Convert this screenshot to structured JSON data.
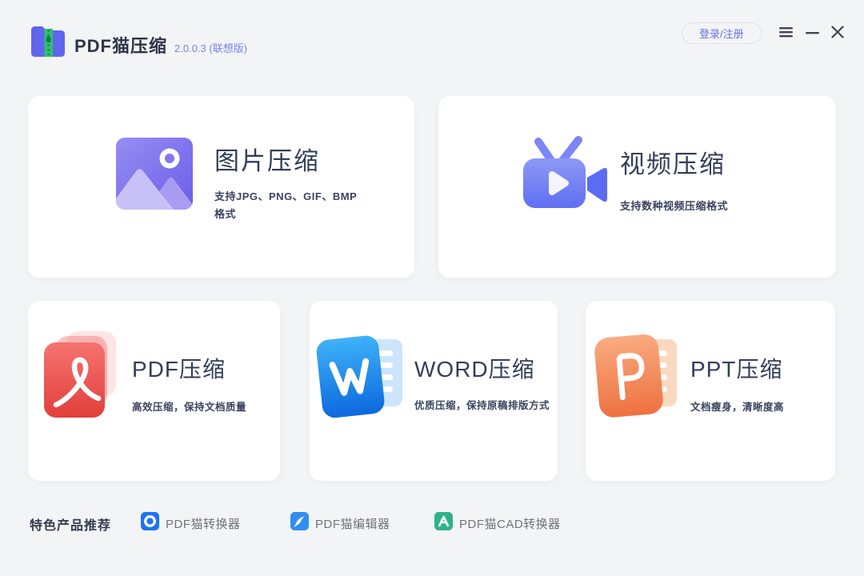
{
  "window": {
    "app_title": "PDF猫压缩",
    "version": "2.0.0.3 (联想版)",
    "login_label": "登录/注册",
    "controls": [
      "menu",
      "minimize",
      "close"
    ]
  },
  "cards": {
    "image": {
      "title": "图片压缩",
      "desc": "支持JPG、PNG、GIF、BMP格式",
      "icon": "image-icon"
    },
    "video": {
      "title": "视频压缩",
      "desc": "支持数种视频压缩格式",
      "icon": "video-camera-icon"
    },
    "pdf": {
      "title": "PDF压缩",
      "desc": "高效压缩，保持文档质量",
      "icon": "pdf-document-icon"
    },
    "word": {
      "title": "WORD压缩",
      "desc": "优质压缩，保持原稿排版方式",
      "icon": "word-document-icon"
    },
    "ppt": {
      "title": "PPT压缩",
      "desc": "文档瘦身，清晰度高",
      "icon": "ppt-document-icon"
    }
  },
  "footer": {
    "label": "特色产品推荐",
    "products": [
      {
        "name": "PDF猫转换器",
        "icon": "converter-icon"
      },
      {
        "name": "PDF猫编辑器",
        "icon": "editor-icon"
      },
      {
        "name": "PDF猫CAD转换器",
        "icon": "cad-converter-icon"
      }
    ]
  },
  "colors": {
    "background": "#f3f4f6",
    "card": "#ffffff",
    "brand_purple": "#6065ee",
    "zipper_green": "#2ec06f",
    "version_text": "#7b82ee",
    "title_text": "#333e58",
    "image_purple": "#6d5fe9",
    "video_periwinkle": "#6372f2",
    "pdf_red": "#e23f3c",
    "word_blue": "#0d68de",
    "ppt_orange": "#ee7140",
    "converter_blue": "#1e74f0",
    "editor_blue": "#2f8ef2",
    "cad_green": "#2eb28c"
  }
}
